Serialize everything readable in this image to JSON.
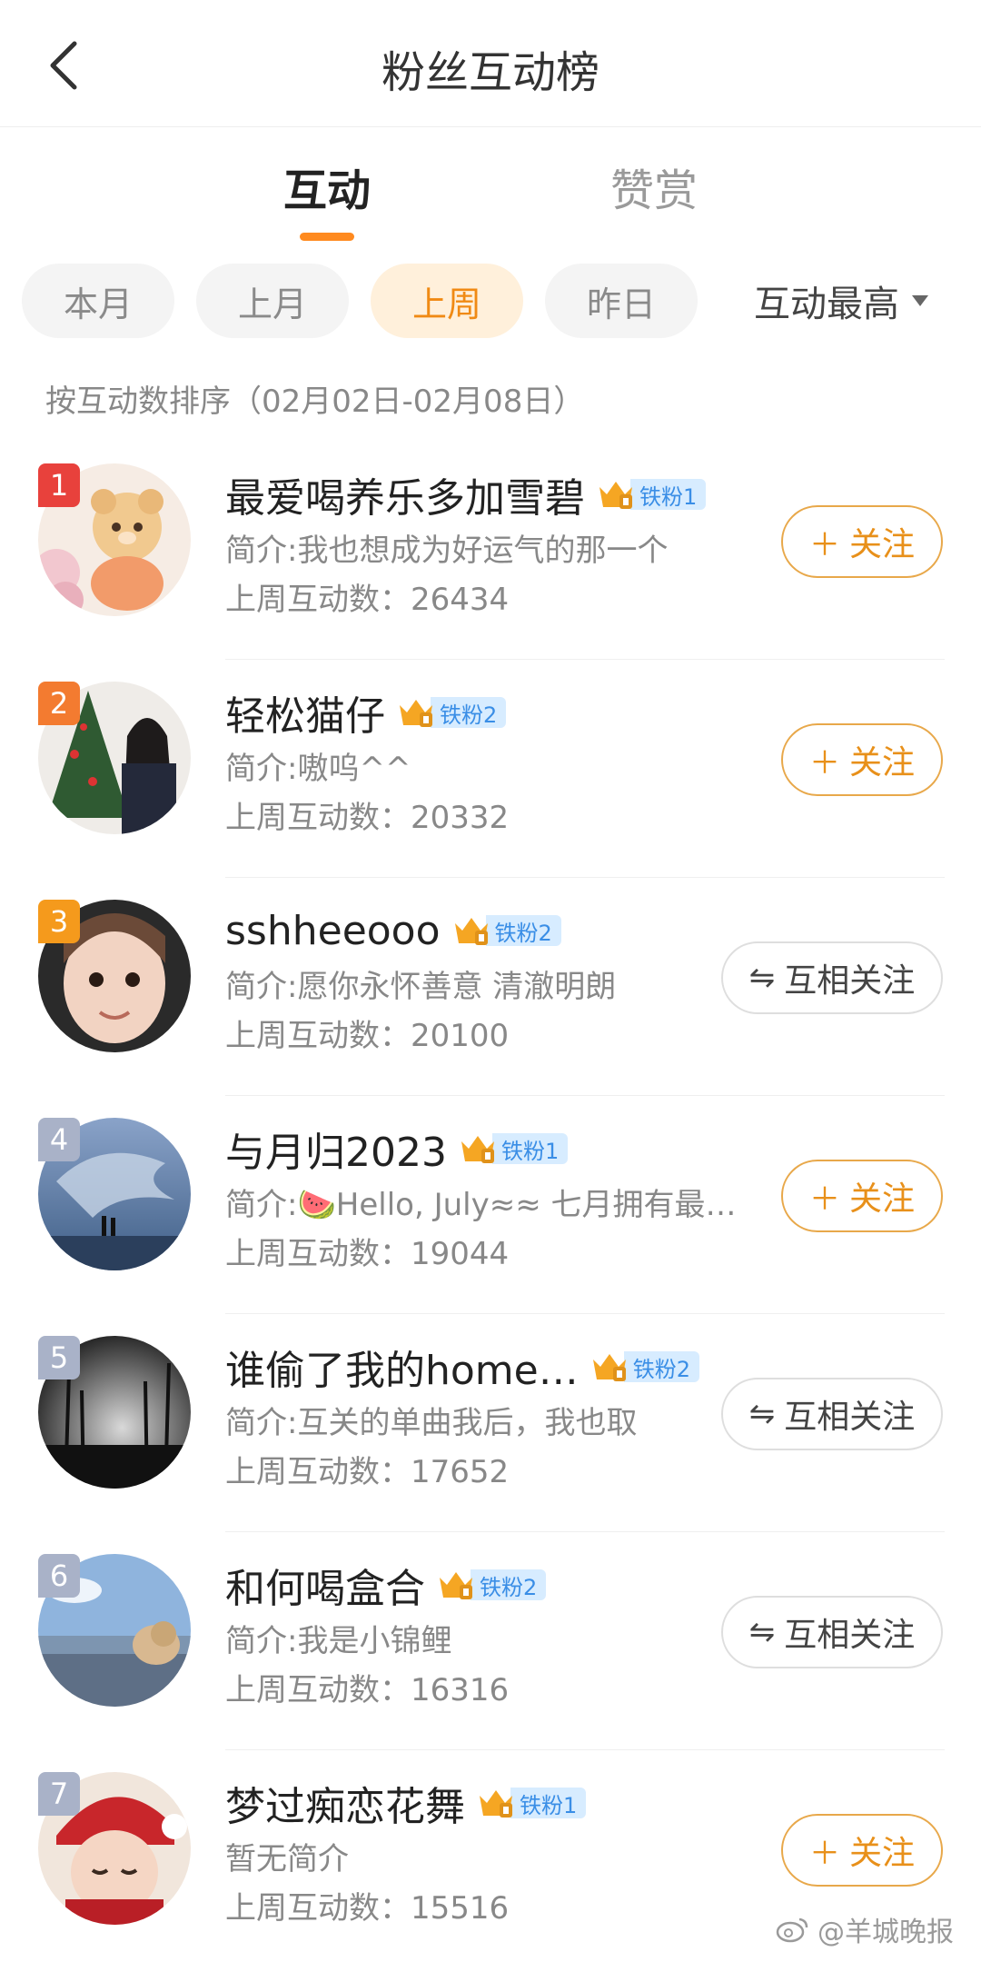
{
  "header": {
    "title": "粉丝互动榜",
    "back_icon": "chevron-left-icon"
  },
  "main_tabs": [
    {
      "label": "互动",
      "active": true
    },
    {
      "label": "赞赏",
      "active": false
    }
  ],
  "filters": [
    {
      "label": "本月",
      "active": false
    },
    {
      "label": "上月",
      "active": false
    },
    {
      "label": "上周",
      "active": true
    },
    {
      "label": "昨日",
      "active": false
    }
  ],
  "sort": {
    "label": "互动最高",
    "icon": "caret-down-icon"
  },
  "sort_note": "按互动数排序（02月02日-02月08日）",
  "colors": {
    "accent": "#ff8a1f",
    "rank_top": [
      "#e8413c",
      "#f37b30",
      "#f59a1c"
    ],
    "rank_other": "#a9b2c8",
    "badge_bg": "#d7ecff",
    "badge_text": "#3a8ee6"
  },
  "buttons": {
    "follow": "关注",
    "mutual": "互相关注"
  },
  "users": [
    {
      "rank": "1",
      "name": "最爱喝养乐多加雪碧",
      "badge": "铁粉1",
      "bio": "简介:我也想成为好运气的那一个",
      "count_label": "上周互动数：",
      "count": "26434",
      "follow_state": "follow"
    },
    {
      "rank": "2",
      "name": "轻松猫仔",
      "badge": "铁粉2",
      "bio": "简介:嗷呜^^",
      "count_label": "上周互动数：",
      "count": "20332",
      "follow_state": "follow"
    },
    {
      "rank": "3",
      "name": "sshheeooo",
      "badge": "铁粉2",
      "bio": "简介:愿你永怀善意 清澈明朗",
      "count_label": "上周互动数：",
      "count": "20100",
      "follow_state": "mutual"
    },
    {
      "rank": "4",
      "name": "与月归2023",
      "badge": "铁粉1",
      "bio": "简介:🍉Hello, July≈≈ 七月拥有最…",
      "count_label": "上周互动数：",
      "count": "19044",
      "follow_state": "follow"
    },
    {
      "rank": "5",
      "name": "谁偷了我的home…",
      "badge": "铁粉2",
      "bio": "简介:互关的单曲我后，我也取",
      "count_label": "上周互动数：",
      "count": "17652",
      "follow_state": "mutual"
    },
    {
      "rank": "6",
      "name": "和何喝盒合",
      "badge": "铁粉2",
      "bio": "简介:我是小锦鲤",
      "count_label": "上周互动数：",
      "count": "16316",
      "follow_state": "mutual"
    },
    {
      "rank": "7",
      "name": "梦过痴恋花舞",
      "badge": "铁粉1",
      "bio": "暂无简介",
      "count_label": "上周互动数：",
      "count": "15516",
      "follow_state": "follow"
    }
  ],
  "watermark": "@羊城晚报"
}
